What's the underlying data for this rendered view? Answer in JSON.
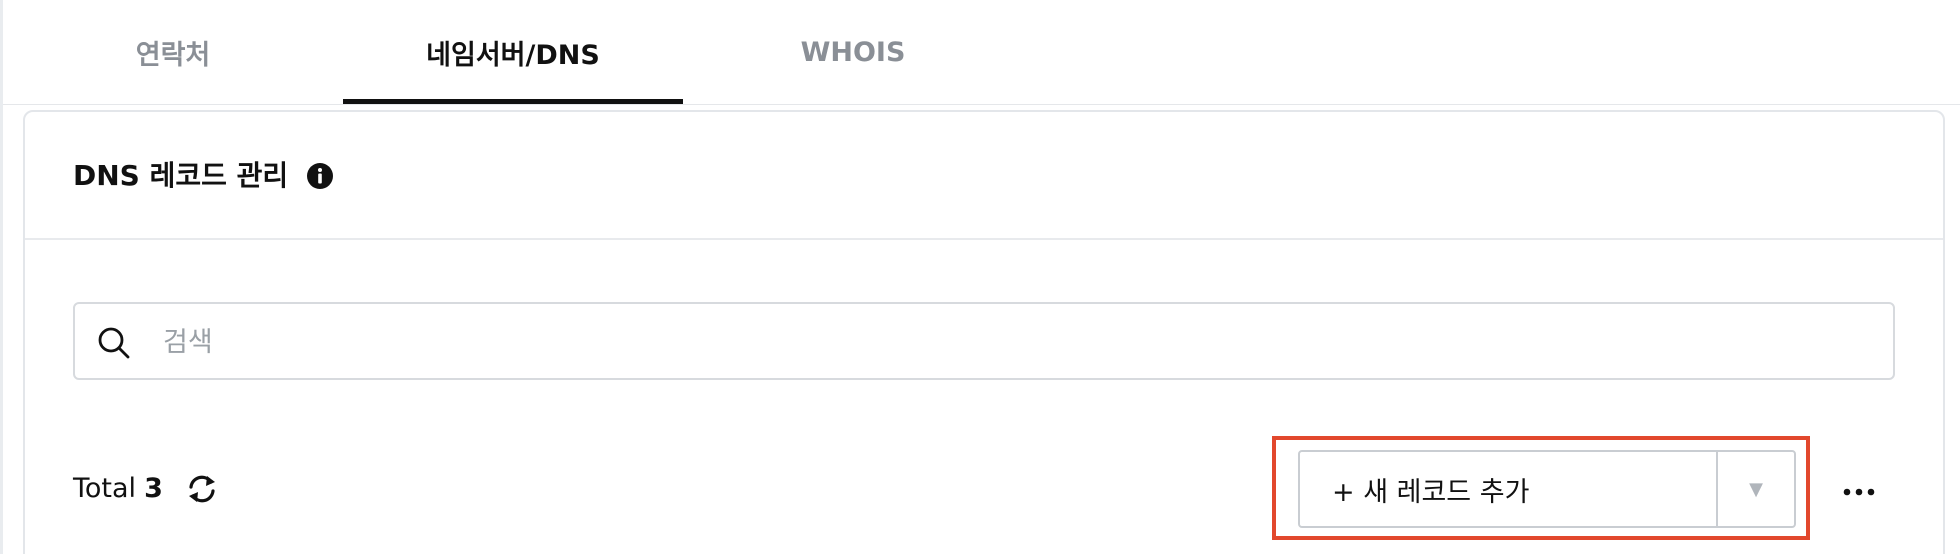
{
  "tabs": [
    {
      "label": "연락처",
      "active": false
    },
    {
      "label": "네임서버/DNS",
      "active": true
    },
    {
      "label": "WHOIS",
      "active": false
    }
  ],
  "panel": {
    "title": "DNS 레코드 관리",
    "info_icon": "info-icon"
  },
  "search": {
    "placeholder": "검색",
    "value": "",
    "icon": "search-icon"
  },
  "toolbar": {
    "total_label": "Total",
    "total_count": "3",
    "refresh_icon": "refresh-icon",
    "add_record_label": "+ 새 레코드 추가",
    "dropdown_caret": "▼",
    "more_icon": "more-horizontal-icon"
  },
  "colors": {
    "active_tab": "#111111",
    "inactive_tab": "#8a8f96",
    "highlight": "#e2482d",
    "border": "#e3e6ea"
  }
}
